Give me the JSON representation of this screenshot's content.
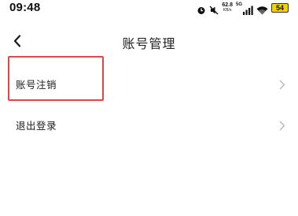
{
  "status_bar": {
    "time": "09:48",
    "speed_value": "62.8",
    "speed_unit": "KB/s",
    "network_type": "5G",
    "battery": "54",
    "battery_color": "#f2d200"
  },
  "header": {
    "title": "账号管理",
    "back_icon": "chevron-left-icon"
  },
  "menu": {
    "items": [
      {
        "label": "账号注销",
        "icon": "chevron-right-icon",
        "highlighted": true
      },
      {
        "label": "退出登录",
        "icon": "chevron-right-icon",
        "highlighted": false
      }
    ]
  },
  "colors": {
    "highlight_border": "#e0454b",
    "chevron": "#b5b5b5",
    "text": "#1c1c1c"
  }
}
